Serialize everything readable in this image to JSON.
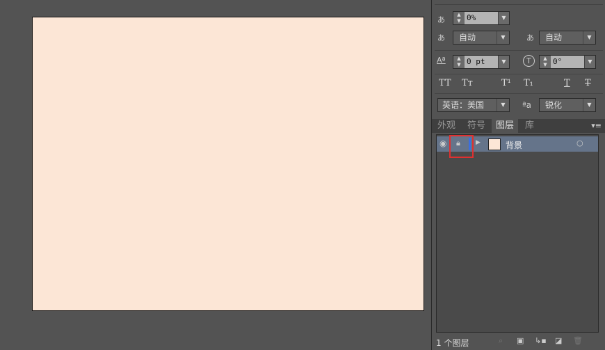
{
  "artboard": {
    "fill": "#fce6d6"
  },
  "character": {
    "tracking_value": "0%",
    "aki_left": "自动",
    "aki_right": "自动",
    "baseline_shift": "0 pt",
    "rotation": "0°",
    "type_buttons": [
      "TT",
      "Tт",
      "T¹",
      "T₁",
      "T",
      "T"
    ],
    "language": "英语：美国",
    "antialias": "锐化"
  },
  "tabs": [
    {
      "label": "外观"
    },
    {
      "label": "符号"
    },
    {
      "label": "图层"
    },
    {
      "label": "库"
    }
  ],
  "active_tab": "图层",
  "layers": [
    {
      "name": "背景",
      "visible": true,
      "locked": true,
      "color": "#3b6fe0",
      "thumbnail": "#fce6d6"
    }
  ],
  "footer": {
    "count": "1 个图层"
  },
  "highlight_color": "#e03030"
}
